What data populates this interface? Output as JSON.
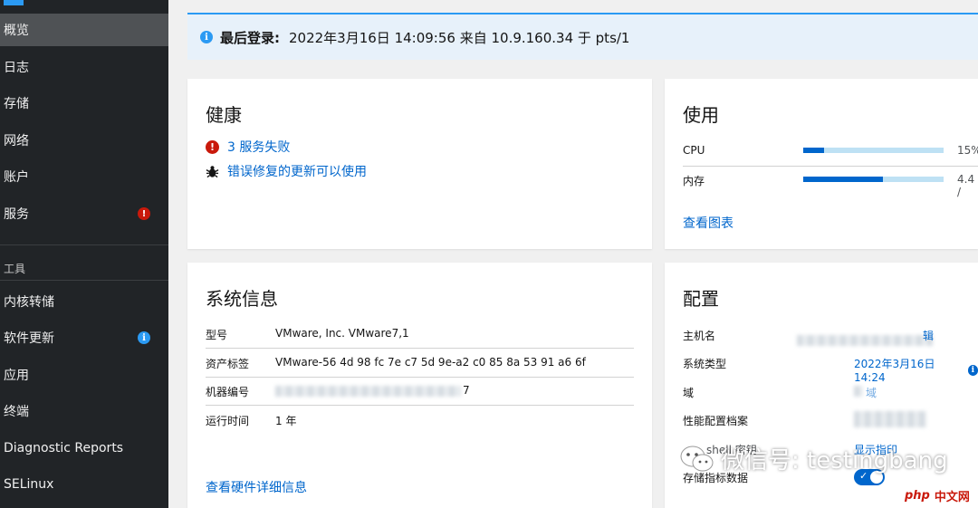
{
  "sidebar": {
    "items": [
      {
        "label": "概览"
      },
      {
        "label": "日志"
      },
      {
        "label": "存储"
      },
      {
        "label": "网络"
      },
      {
        "label": "账户"
      },
      {
        "label": "服务"
      }
    ],
    "tools_heading": "工具",
    "tools": [
      {
        "label": "内核转储"
      },
      {
        "label": "软件更新"
      },
      {
        "label": "应用"
      },
      {
        "label": "终端"
      },
      {
        "label": "Diagnostic Reports"
      },
      {
        "label": "SELinux"
      }
    ],
    "service_badge": "!",
    "update_badge": "i"
  },
  "alert": {
    "title": "最后登录:",
    "text": "2022年3月16日 14:09:56 来自 10.9.160.34 于 pts/1"
  },
  "health": {
    "title": "健康",
    "failed_services": "3 服务失败",
    "bugfix_updates": "错误修复的更新可以使用"
  },
  "usage": {
    "title": "使用",
    "cpu_label": "CPU",
    "cpu_value": "15%",
    "cpu_fraction": 0.15,
    "mem_label": "内存",
    "mem_value": "4.4 /",
    "mem_fraction": 0.57,
    "view_charts": "查看图表"
  },
  "sysinfo": {
    "title": "系统信息",
    "rows": [
      {
        "label": "型号",
        "value": "VMware, Inc. VMware7,1"
      },
      {
        "label": "资产标签",
        "value": "VMware-56 4d 98 fc 7e c7 5d 9e-a2 c0 85 8a 53 91 a6 6f"
      },
      {
        "label": "机器编号",
        "value": "7"
      },
      {
        "label": "运行时间",
        "value": "1 年"
      }
    ],
    "details_link": "查看硬件详细信息"
  },
  "config": {
    "title": "配置",
    "hostname_label": "主机名",
    "hostname_value": "辑",
    "systime_label": "系统类型",
    "systime_value": "2022年3月16日 14:24",
    "domain_label": "域",
    "domain_value": "域",
    "profile_label": "性能配置档案",
    "ssh_label": "shell 密钥",
    "ssh_value": "显示指印",
    "metrics_label": "存储指标数据"
  },
  "watermark": {
    "text": "微信号: testingbang",
    "site_php": "php",
    "site_cn": "中文网"
  },
  "colors": {
    "sidebar_bg": "#212427",
    "accent": "#0066cc",
    "danger": "#c9190b",
    "info": "#2b9af3"
  }
}
